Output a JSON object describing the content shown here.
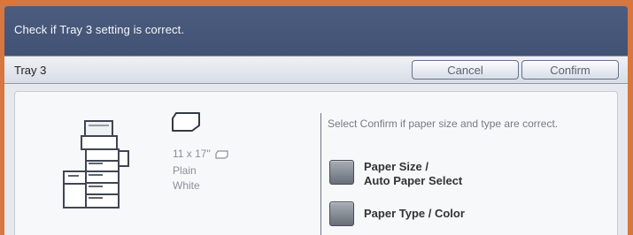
{
  "message": {
    "text": "Check if Tray 3 setting is correct."
  },
  "title_bar": {
    "title": "Tray 3",
    "cancel_label": "Cancel",
    "confirm_label": "Confirm"
  },
  "tray_info": {
    "size": "11 x 17\"",
    "type": "Plain",
    "color": "White"
  },
  "instruction": "Select Confirm if paper size and type are correct.",
  "options": {
    "paper_size_line1": "Paper Size /",
    "paper_size_line2": "Auto Paper Select",
    "paper_type": "Paper Type / Color"
  },
  "icons": {
    "printer": "printer-icon",
    "paper": "paper-orientation-icon",
    "paper_small": "paper-orientation-small-icon"
  },
  "colors": {
    "bezel": "#d8763f",
    "header": "#4b5c7e",
    "panel": "#e6e8ee",
    "content": "#f7f8fa"
  }
}
